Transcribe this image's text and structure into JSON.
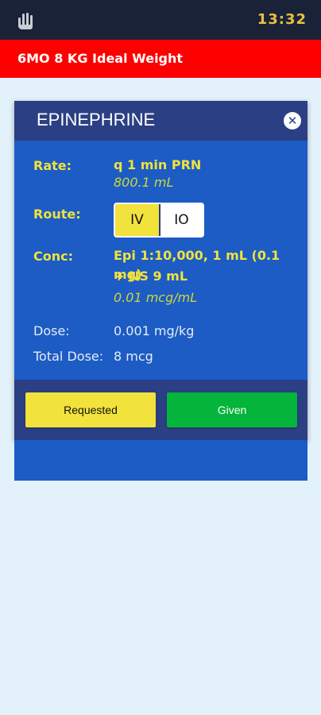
{
  "status_bar": {
    "time": "13:32",
    "app_icon": "hand-icon"
  },
  "patient": {
    "banner": "6MO 8 KG Ideal Weight"
  },
  "drug_card": {
    "title": "EPINEPHRINE",
    "close_icon": "close-icon",
    "rate": {
      "label": "Rate:",
      "value": "q 1 min PRN",
      "sub": "800.1 mL"
    },
    "route": {
      "label": "Route:",
      "options": [
        "IV",
        "IO"
      ],
      "selected": "IV"
    },
    "conc": {
      "label": "Conc:",
      "line1": "Epi 1:10,000, 1 mL (0.1 mg)",
      "line2": "+ NS 9 mL",
      "sub": "0.01 mcg/mL"
    },
    "dose": {
      "label": "Dose:",
      "value": "0.001 mg/kg"
    },
    "total_dose": {
      "label": "Total Dose:",
      "value": "8 mcg"
    },
    "buttons": {
      "requested": "Requested",
      "given": "Given"
    }
  },
  "colors": {
    "status_bar": "#1a2238",
    "banner": "#ff0000",
    "card_header": "#2b3f84",
    "card_body": "#1c5cc4",
    "accent_yellow": "#f1e23c",
    "given_green": "#05b43a",
    "page_bg": "#e3f1fb"
  }
}
